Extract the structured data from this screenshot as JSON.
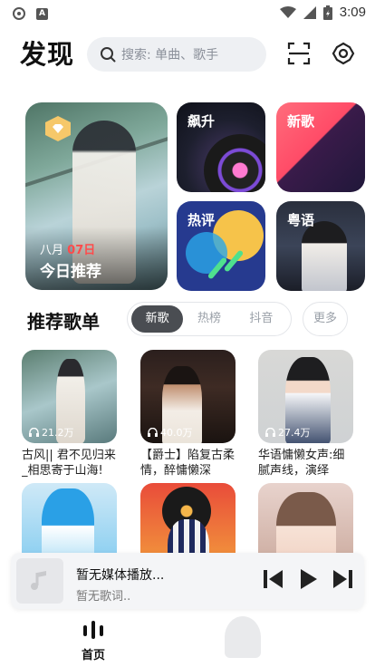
{
  "status": {
    "time": "3:09"
  },
  "header": {
    "title": "发现",
    "search_placeholder": "搜索: 单曲、歌手"
  },
  "featured": {
    "daily": {
      "month": "八月",
      "day": "07日",
      "label": "今日推荐"
    },
    "cards": [
      {
        "label": "飙升"
      },
      {
        "label": "新歌"
      },
      {
        "label": "热评"
      },
      {
        "label": "粤语"
      }
    ]
  },
  "playlists": {
    "title": "推荐歌单",
    "tabs": [
      "新歌",
      "热榜",
      "抖音"
    ],
    "active_tab": "新歌",
    "more_label": "更多",
    "items": [
      {
        "count": "21.2万",
        "name": "古风|| 君不见归来_相思寄于山海!"
      },
      {
        "count": "40.0万",
        "name": "【爵士】陷复古柔情，醉慵懒深"
      },
      {
        "count": "27.4万",
        "name": "华语慵懒女声:细腻声线，演绎"
      },
      {
        "count": "",
        "name": ""
      },
      {
        "count": "",
        "name": ""
      },
      {
        "count": "",
        "name": ""
      }
    ]
  },
  "player": {
    "title": "暂无媒体播放...",
    "lyrics": "暂无歌词.."
  },
  "nav": {
    "home_label": "首页"
  },
  "colors": {
    "accent_red": "#ff4b4b",
    "tab_active": "#4a4d52"
  }
}
